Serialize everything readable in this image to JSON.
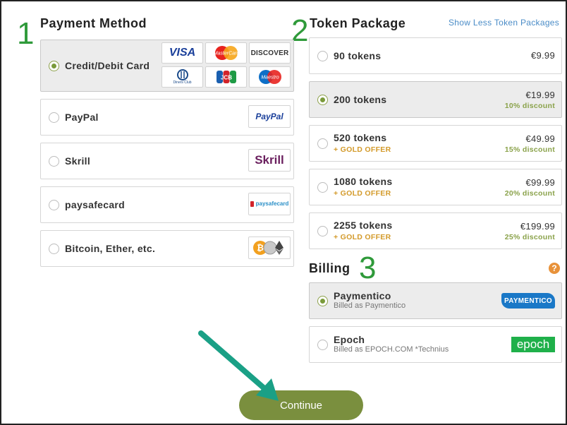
{
  "steps": {
    "one": "1",
    "two": "2",
    "three": "3"
  },
  "payment": {
    "title": "Payment Method",
    "methods": [
      {
        "label": "Credit/Debit Card",
        "selected": true,
        "logos": [
          "VISA",
          "MasterCard",
          "DISCOVER",
          "Diners Club",
          "JCB",
          "Maestro"
        ]
      },
      {
        "label": "PayPal",
        "selected": false,
        "logo": "PayPal"
      },
      {
        "label": "Skrill",
        "selected": false,
        "logo": "Skrill"
      },
      {
        "label": "paysafecard",
        "selected": false,
        "logo": "paysafecard"
      },
      {
        "label": "Bitcoin, Ether, etc.",
        "selected": false,
        "logo": "crypto"
      }
    ]
  },
  "tokens": {
    "title": "Token Package",
    "toggle_link": "Show Less Token Packages",
    "packages": [
      {
        "name": "90 tokens",
        "price": "€9.99",
        "discount": "",
        "offer": "",
        "selected": false
      },
      {
        "name": "200 tokens",
        "price": "€19.99",
        "discount": "10% discount",
        "offer": "",
        "selected": true
      },
      {
        "name": "520 tokens",
        "price": "€49.99",
        "discount": "15% discount",
        "offer": "+ GOLD OFFER",
        "selected": false
      },
      {
        "name": "1080 tokens",
        "price": "€99.99",
        "discount": "20% discount",
        "offer": "+ GOLD OFFER",
        "selected": false
      },
      {
        "name": "2255 tokens",
        "price": "€199.99",
        "discount": "25% discount",
        "offer": "+ GOLD OFFER",
        "selected": false
      }
    ]
  },
  "billing": {
    "title": "Billing",
    "help": "?",
    "options": [
      {
        "name": "Paymentico",
        "billed_prefix": "Billed as",
        "billed_as": "Paymentico",
        "logo": "PAYMENTICO",
        "selected": true
      },
      {
        "name": "Epoch",
        "billed_prefix": "Billed as",
        "billed_as": "EPOCH.COM *Technius",
        "logo": "epoch",
        "selected": false
      }
    ]
  },
  "continue_label": "Continue",
  "colors": {
    "step_number": "#2f9a3a",
    "accent_green": "#7a8f3e",
    "discount": "#8aa24a",
    "gold": "#d39a2a",
    "link": "#4a8cc7",
    "arrow": "#1aa086"
  }
}
